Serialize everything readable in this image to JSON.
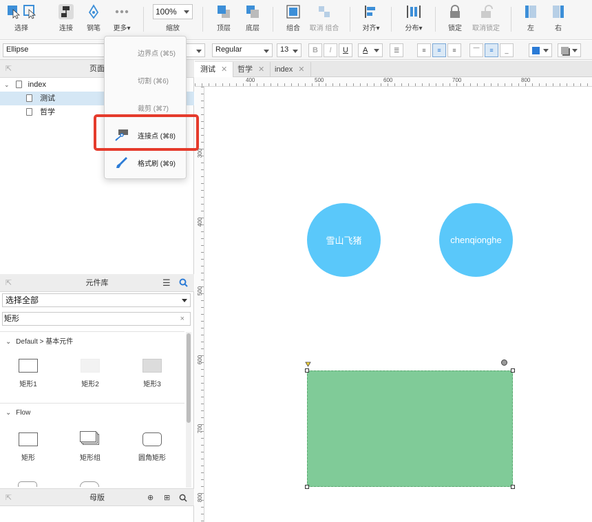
{
  "toolbar": {
    "select_label": "选择",
    "connect_label": "连接",
    "pen_label": "钢笔",
    "more_label": "更多▾",
    "zoom_value": "100%",
    "zoom_label": "缩放",
    "top_layer_label": "顶层",
    "bottom_layer_label": "底层",
    "group_label": "组合",
    "ungroup_label": "取消 组合",
    "align_label": "对齐▾",
    "distribute_label": "分布▾",
    "lock_label": "锁定",
    "unlock_label": "取消锁定",
    "left_label": "左",
    "right_label": "右"
  },
  "formatbar": {
    "shape_name": "Ellipse",
    "font_style": "Regular",
    "font_size": "13",
    "bold": "B",
    "italic": "I",
    "underline": "U",
    "text_color_label": "A"
  },
  "more_menu": {
    "items": [
      {
        "label": "边界点 (⌘5)",
        "disabled": true
      },
      {
        "label": "切割 (⌘6)",
        "disabled": true
      },
      {
        "label": "裁剪 (⌘7)",
        "disabled": true
      },
      {
        "label": "连接点 (⌘8)",
        "disabled": false
      },
      {
        "label": "格式刷 (⌘9)",
        "disabled": false
      }
    ]
  },
  "pages_panel": {
    "title": "页面",
    "root": "index",
    "pages": [
      "测试",
      "哲学"
    ]
  },
  "library_panel": {
    "title": "元件库",
    "select_all": "选择全部",
    "search_value": "矩形",
    "sections": [
      {
        "title": "Default > 基本元件",
        "items": [
          "矩形1",
          "矩形2",
          "矩形3"
        ]
      },
      {
        "title": "Flow",
        "items": [
          "矩形",
          "矩形组",
          "圆角矩形"
        ]
      }
    ]
  },
  "masters_panel": {
    "title": "母版"
  },
  "tabs": [
    "测试",
    "哲学",
    "index"
  ],
  "ruler": {
    "top_ticks": [
      "400",
      "500",
      "600",
      "700",
      "800"
    ],
    "left_ticks": [
      "300",
      "400",
      "500",
      "600",
      "700",
      "800"
    ]
  },
  "canvas": {
    "circle1_text": "雪山飞猪",
    "circle2_text": "chenqionghe"
  },
  "colors": {
    "accent": "#2b7bd6",
    "circle": "#5ac8fa",
    "rect_fill": "#80cb98",
    "highlight": "#e53b2c"
  }
}
